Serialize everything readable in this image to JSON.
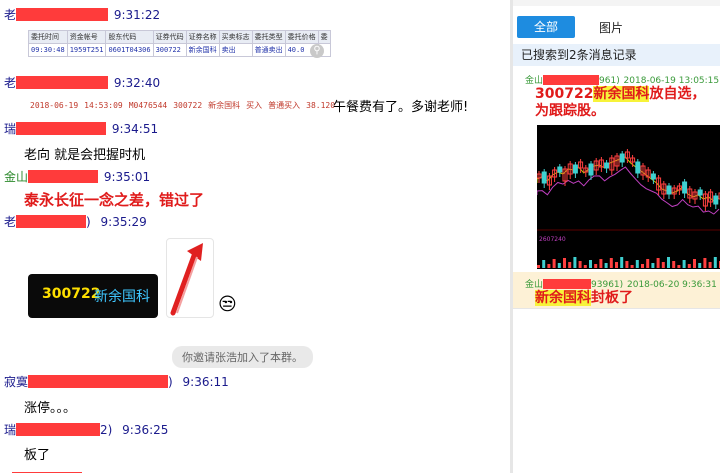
{
  "chat": {
    "messages": [
      {
        "sender": "老",
        "time": "9:31:22"
      },
      {
        "sender": "老",
        "time": "9:32:40",
        "text": "午餐费有了。多谢老师!"
      },
      {
        "sender": "瑞",
        "time": "9:34:51",
        "text": "老向 就是会把握时机"
      },
      {
        "sender": "金山",
        "time": "9:35:01",
        "text": "泰永长征一念之差，错过了"
      },
      {
        "sender": "老",
        "time": "9:35:29"
      },
      {
        "sender": "寂寞",
        "time": "9:36:11",
        "text": "涨停。。。"
      },
      {
        "sender": "瑞",
        "time": "9:36:25",
        "text": "板了"
      }
    ],
    "name_suffix_5": ")",
    "name_suffix_6": ")",
    "name_suffix_7": "2)",
    "system_notice": "你邀请张浩加入了本群。",
    "order_table": {
      "headers": [
        "委托时间",
        "资金帐号",
        "股东代码",
        "证券代码",
        "证券名称",
        "买卖标志",
        "委托类型",
        "委托价格",
        "委"
      ],
      "row": [
        "09:30:48",
        "1959T251",
        "0601T04306",
        "300722",
        "新余国科",
        "卖出",
        "普通卖出",
        "40.0",
        ""
      ]
    },
    "trade_strip": [
      "2018-06-19",
      "14:53:09",
      "M0476544",
      "300722",
      "新余国科",
      "买入",
      "普通买入",
      "38.120"
    ],
    "stock_card": {
      "code": "300722",
      "name": "新余国科"
    },
    "emoji": "😒"
  },
  "search": {
    "tabs": {
      "all": "全部",
      "images": "图片"
    },
    "found_text": "已搜索到2条消息记录",
    "results": [
      {
        "sender": "金山",
        "id_suffix": "961)",
        "date": "2018-06-19 13:05:15",
        "code": "300722",
        "name": "新余国科",
        "text_after": "放自选，",
        "line2": "为跟踪股。"
      },
      {
        "sender": "金山",
        "id_suffix": "93961)",
        "date": "2018-06-20 9:36:31",
        "name": "新余国科",
        "text_after": "封板了"
      }
    ],
    "chart_label": "2607240"
  },
  "colors": {
    "accent": "#1e8ce0",
    "highlight": "#f7f33a",
    "red_text": "#e01b1b",
    "sender_blue": "#1a1a8c"
  }
}
